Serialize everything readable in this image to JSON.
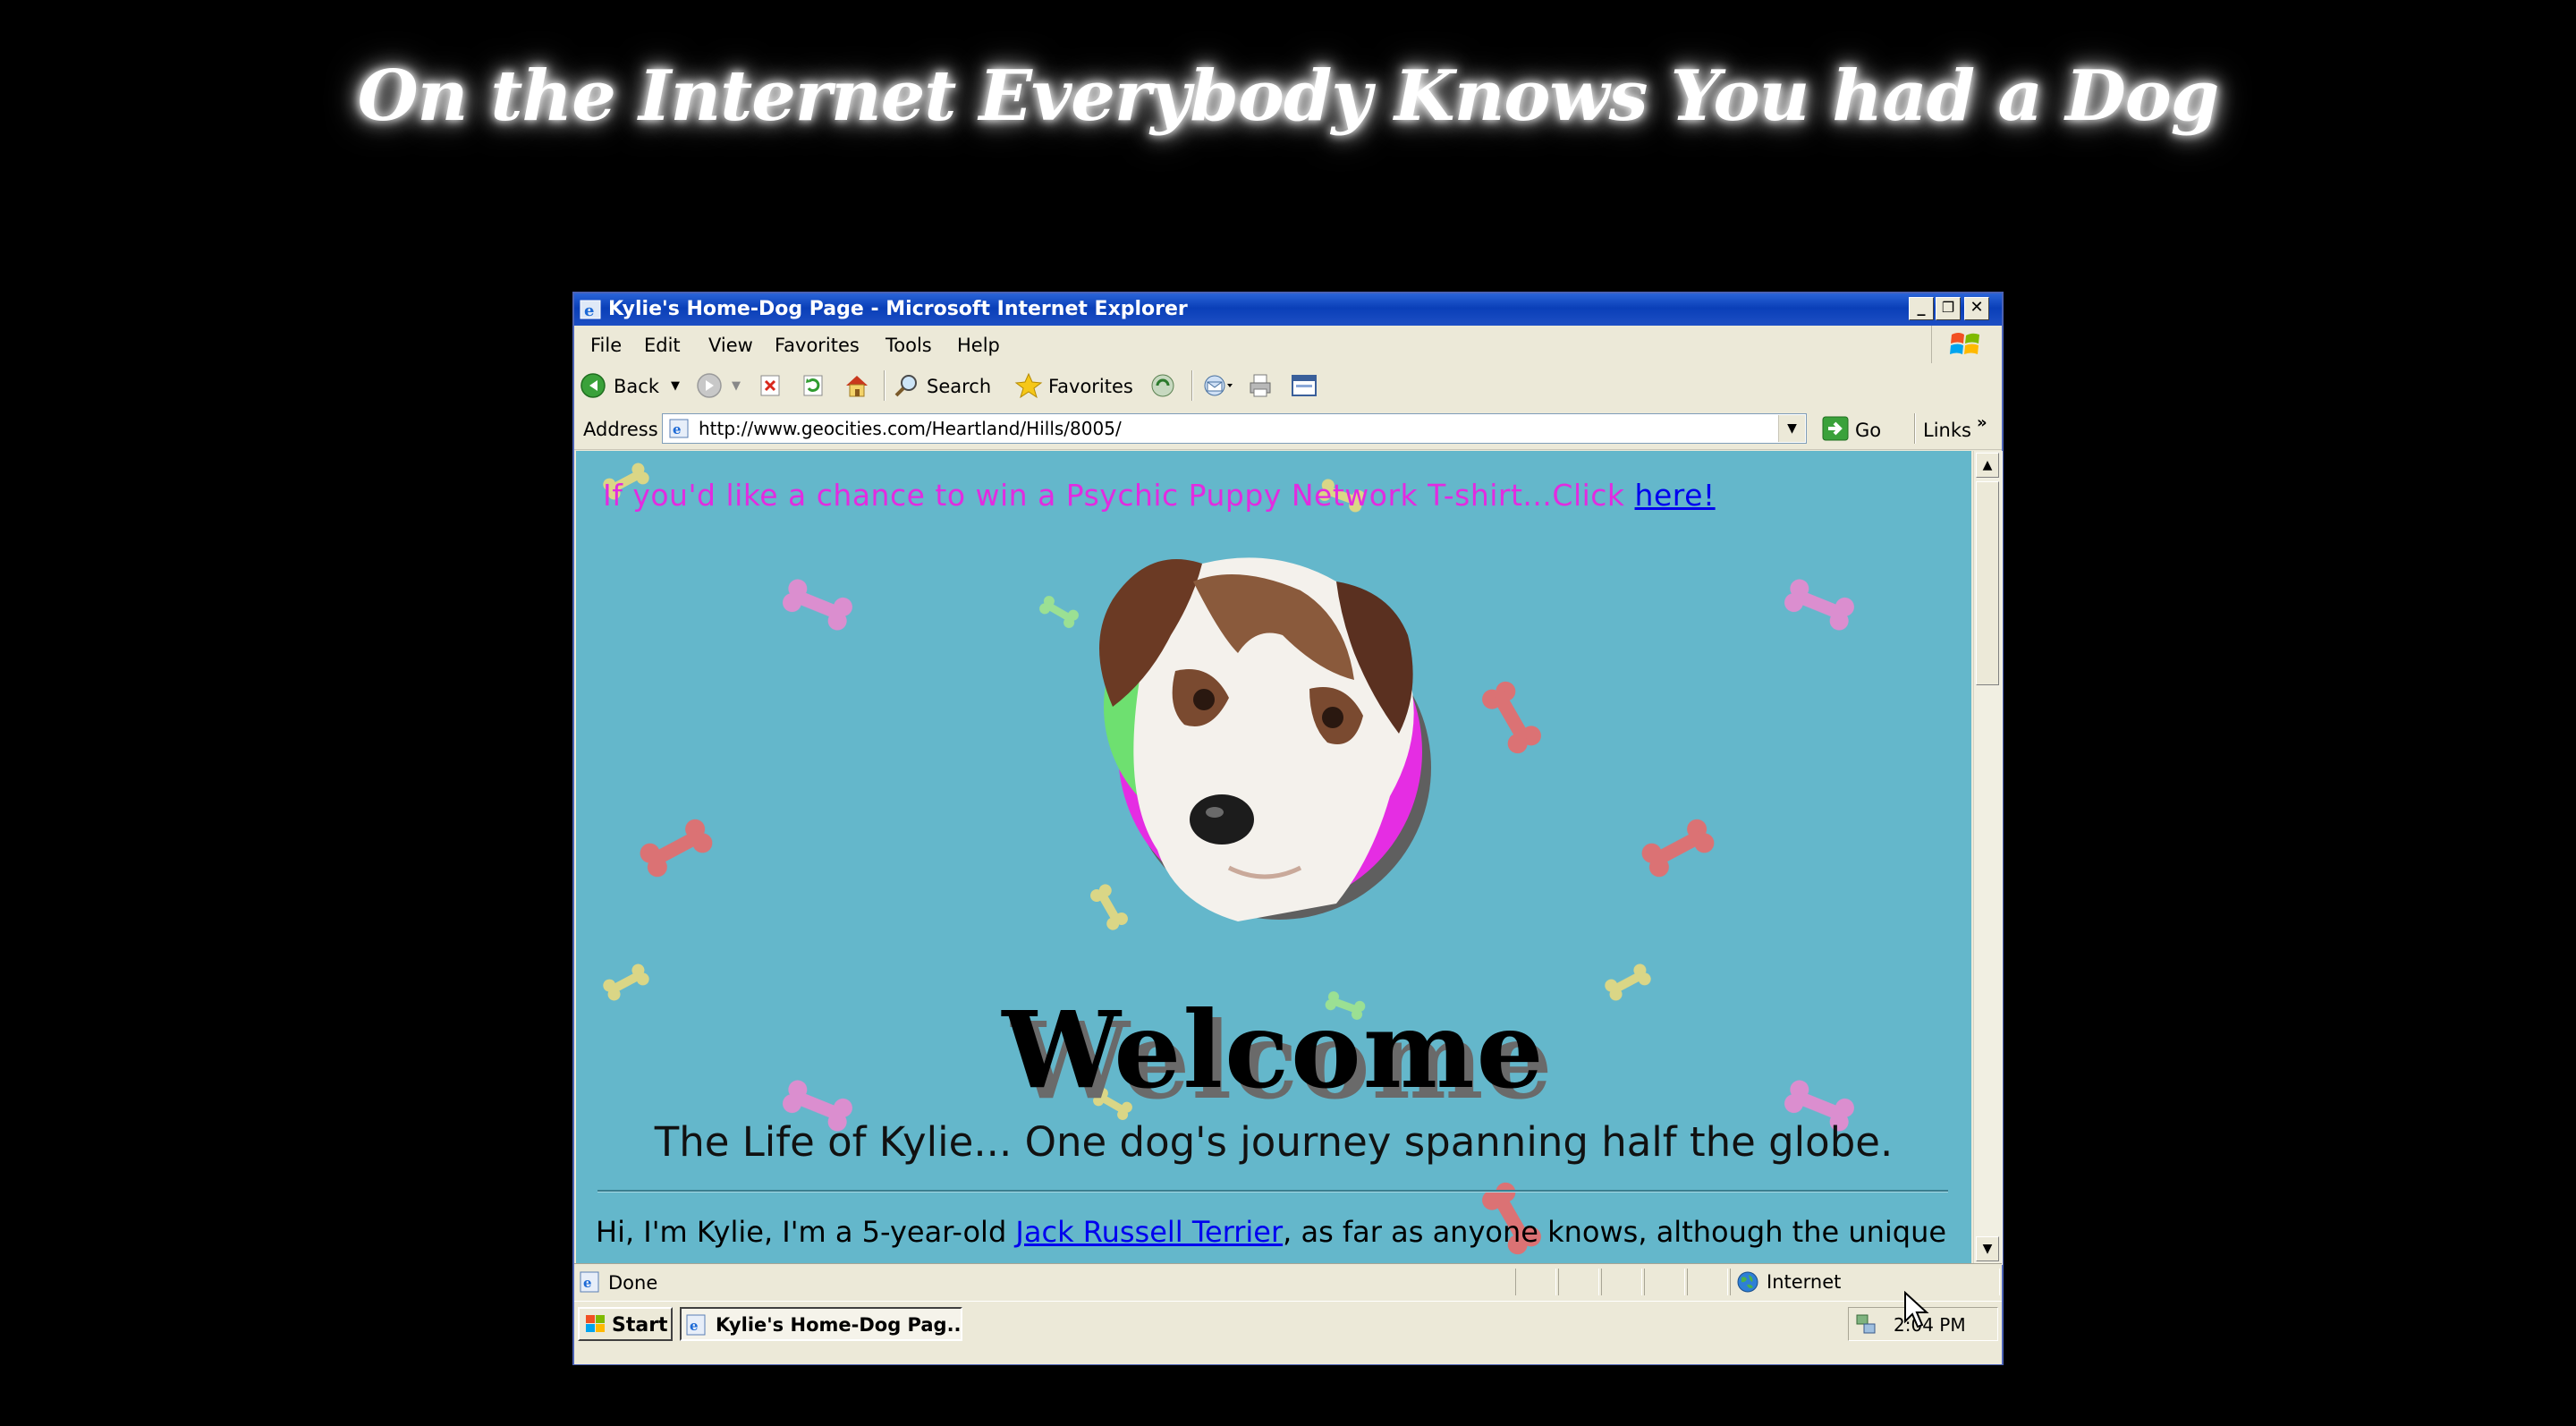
{
  "page_title": "On the Internet Everybody Knows You had a Dog",
  "window": {
    "title": "Kylie's Home-Dog Page - Microsoft Internet Explorer",
    "controls": {
      "minimize": "_",
      "restore": "❐",
      "close": "✕"
    }
  },
  "menu": [
    "File",
    "Edit",
    "View",
    "Favorites",
    "Tools",
    "Help"
  ],
  "toolbar": {
    "back_label": "Back",
    "search_label": "Search",
    "favorites_label": "Favorites"
  },
  "address": {
    "label": "Address",
    "url": "http://www.geocities.com/Heartland/Hills/8005/",
    "go_label": "Go",
    "links_label": "Links"
  },
  "content": {
    "contest_text": "If you'd like a chance to win a Psychic Puppy Network T-shirt...Click ",
    "contest_link": "here!",
    "welcome": "Welcome",
    "subtitle": "The Life of Kylie... One dog's journey spanning half the globe.",
    "intro_before": "Hi, I'm Kylie, I'm a 5-year-old ",
    "intro_link": "Jack Russell Terrier",
    "intro_after": ", as far as anyone knows, although the unique color"
  },
  "status": {
    "text": "Done",
    "zone": "Internet"
  },
  "taskbar": {
    "start_label": "Start",
    "task_label": "Kylie's Home-Dog Pag...",
    "clock": "2:04 PM"
  },
  "colors": {
    "page_background": "#64b7cb",
    "contest_text": "#e22be0",
    "link": "#0000ee",
    "titlebar": "#0a3fb8"
  }
}
